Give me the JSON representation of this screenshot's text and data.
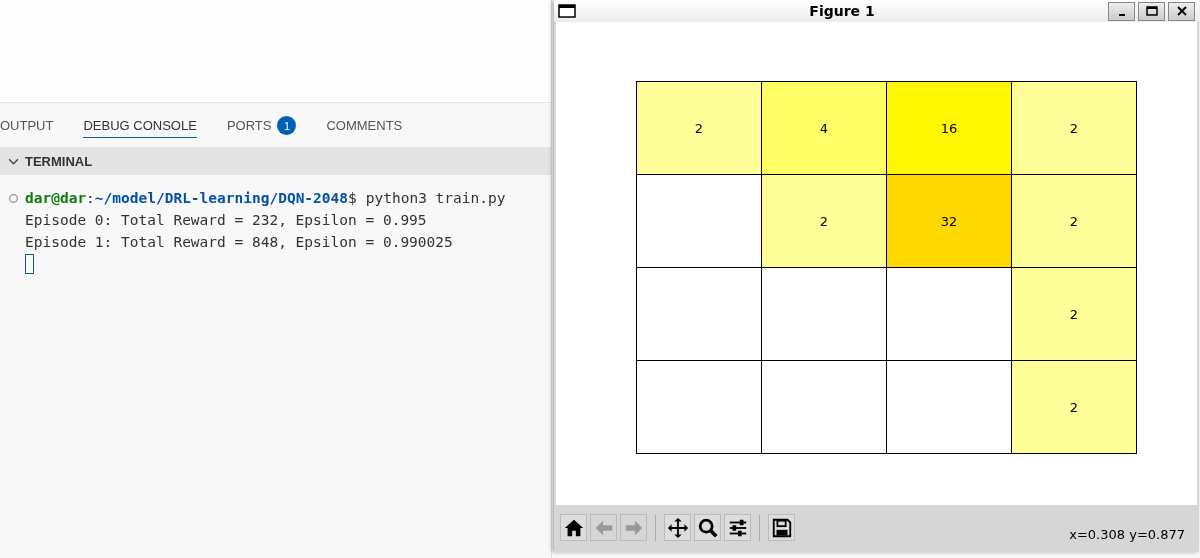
{
  "panel": {
    "tabs": [
      {
        "label": "OUTPUT",
        "selected": false
      },
      {
        "label": "DEBUG CONSOLE",
        "selected": true
      },
      {
        "label": "PORTS",
        "selected": false,
        "badge": "1"
      },
      {
        "label": "COMMENTS",
        "selected": false
      }
    ],
    "section": {
      "title": "TERMINAL",
      "expanded": true
    },
    "terminal": {
      "prompt_user": "dar@dar",
      "prompt_sep": ":",
      "prompt_path": "~/model/DRL-learning/DQN-2048",
      "prompt_symbol": "$",
      "command": "python3 train.py",
      "output": [
        "Episode 0: Total Reward = 232, Epsilon = 0.995",
        "Episode 1: Total Reward = 848, Epsilon = 0.990025"
      ]
    }
  },
  "figure_window": {
    "title": "Figure 1",
    "grid": [
      [
        {
          "value": "2",
          "color": "#ffff99"
        },
        {
          "value": "4",
          "color": "#ffff66"
        },
        {
          "value": "16",
          "color": "#fff700"
        },
        {
          "value": "2",
          "color": "#ffff99"
        }
      ],
      [
        {
          "color": "#ffffff"
        },
        {
          "value": "2",
          "color": "#ffff99"
        },
        {
          "value": "32",
          "color": "#ffd800"
        },
        {
          "value": "2",
          "color": "#ffff99"
        }
      ],
      [
        {
          "color": "#ffffff"
        },
        {
          "color": "#ffffff"
        },
        {
          "color": "#ffffff"
        },
        {
          "value": "2",
          "color": "#ffff99"
        }
      ],
      [
        {
          "color": "#ffffff"
        },
        {
          "color": "#ffffff"
        },
        {
          "color": "#ffffff"
        },
        {
          "value": "2",
          "color": "#ffff99"
        }
      ]
    ],
    "toolbar": [
      {
        "kind": "home",
        "disabled": false
      },
      {
        "kind": "back",
        "disabled": true
      },
      {
        "kind": "forward",
        "disabled": true
      },
      {
        "kind": "pan",
        "disabled": false
      },
      {
        "kind": "zoom",
        "disabled": false
      },
      {
        "kind": "configure",
        "disabled": false
      },
      {
        "kind": "save",
        "disabled": false
      }
    ],
    "coordinates": "x=0.308 y=0.877"
  }
}
